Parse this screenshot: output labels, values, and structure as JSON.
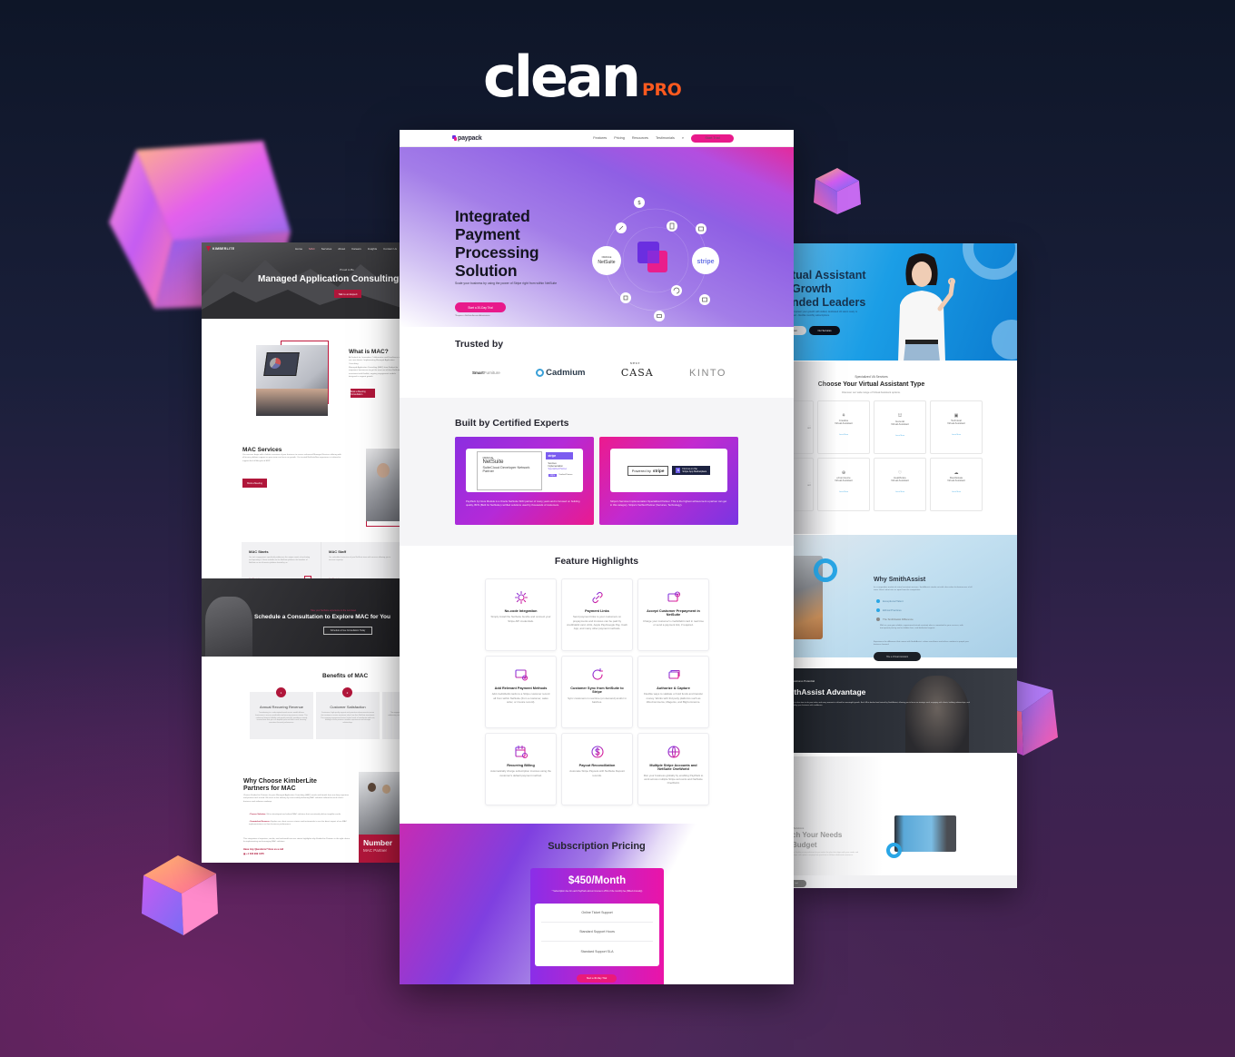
{
  "brand": {
    "word": "clean",
    "suffix": "PRO",
    "accent_color": "#ff5a1f"
  },
  "left_site": {
    "logo": "KIMBERLITE",
    "nav": [
      "Home",
      "MAC",
      "Services",
      "About",
      "Careers",
      "Insights",
      "Contact Us"
    ],
    "hero": {
      "kicker": "Proud to Be",
      "title": "Managed Application Consulting",
      "button": "Talk to an Expert"
    },
    "what_is": {
      "title": "What is MAC?",
      "text1": "At KimberLite, Innovation, Collaboration and Excellence are our core drivers. Implementing Managed Application Consulting.",
      "text2": "Managed Application Consulting (MAC) from KimberLite empowers businesses to get the most out of their NetSuite investment with flexible, ongoing engagement models designed to support growth.",
      "button": "Book a Meeting Consultation"
    },
    "services": {
      "title": "MAC Services",
      "text": "Our services begin with a holistic overview of your business to assess enhanced Managed Services offering with all-in-one platform support so your team can focus on growth. Our trusted NetSuiteNow experience is tailored to support the full lifecycle of ERP.",
      "button": "Book a Meeting"
    },
    "cards": [
      {
        "title": "MAC Starts",
        "text": "Our tech engagement specifically addresses the unique needs of evaluating and operating a 1-item scalable via the NetSuite platform: the baseline of NetSuite as an all-service platform hosted by us.",
        "link": "Get Started"
      },
      {
        "title": "MAC Staff",
        "text": "Our embedded extension of your NetSuite team with services allowing you to increase capacity.",
        "link": "Get Started"
      }
    ],
    "cta": {
      "kicker": "Take your NetSuite experience to the next level",
      "title": "Schedule a Consultation to Explore MAC for You",
      "button": "Schedule a Free Consultation Today"
    },
    "benefits": {
      "title": "Benefits of MAC",
      "items": [
        {
          "num": "1",
          "title": "Annual Recurring Revenue",
          "text": "Transitioning to a subscription-based service model delivers businesses a secure, predictable and recurring revenue stream. This enhances financial stability and growth potential, providing a steady income base that you can depend upon and often used, ensuring consistent financial performance."
        },
        {
          "num": "2",
          "title": "Customer Satisfaction",
          "text": "Continuous, high-quality support and proactive enhancements ensure that customers receive maximum value from their NetSuite investment. This ongoing engagement fosters higher levels of satisfaction and trust, leading to more positive customer experiences and stronger relationships."
        },
        {
          "num": "3",
          "title": "Cu",
          "text": "The engagement model fosters strong, long-term relationships, addressing customer needs and ensuring consistent satisfaction and higher retention rates."
        }
      ]
    },
    "why": {
      "title": "Why Choose KimberLite Partners for MAC",
      "text": "Choose KimberLite Partners for your Managed Application Consulting (MAC) needs and benefit from our deep expertise and proven track record. We excel in the industry by successfully delivering MAC solutions tailored to each client's business and software roadmap.",
      "bullets": [
        {
          "label": "Proven Solution:",
          "text": "We've developed and refined MAC solutions that consistently deliver tangible results."
        },
        {
          "label": "Unmatched Success:",
          "text": "Explore our client success stories and testimonials to see the direct impact of our MAC implementations on their business performance."
        }
      ],
      "closing": "This integration of expertise, results, and real-world success stories highlights why KimberLite Partners is the right choice for implementing and managing MAC solutions.",
      "contact_label": "Have Any Questions? Give us a call",
      "phone": "+1 333 999 4476",
      "badge_title": "Number",
      "badge_sub": "MAC Partner"
    },
    "accent_color": "#b0163a"
  },
  "center_site": {
    "logo": "paypack",
    "nav": [
      "Features",
      "Pricing",
      "Resources",
      "Testimonials"
    ],
    "nav_button": "Start Trial",
    "hero": {
      "title": "Integrated Payment Processing Solution",
      "subtitle": "Scale your business by using the power of Stripe right from within NetSuite",
      "button": "Start a 30-Day Trial",
      "note": "*Requires a NetSuite Account Administrator",
      "orbit_labels": {
        "left": "NetSuite",
        "left_small": "ORACLE",
        "right": "stripe"
      }
    },
    "trusted": {
      "title": "Trusted by",
      "logos": [
        {
          "name": "SmartFurniture",
          "bold": "Smart",
          "light": "Furniture"
        },
        {
          "name": "Cadmium",
          "text": "Cadmium"
        },
        {
          "name": "Nest Casa",
          "small": "NEST",
          "text": "CASA"
        },
        {
          "name": "Kinto",
          "text": "KINTO"
        }
      ]
    },
    "certified": {
      "title": "Built by Certified Experts",
      "cards": [
        {
          "badge1": {
            "small": "ORACLE",
            "name": "NetSuite",
            "desc": "SuiteCloud Developer Network Partner"
          },
          "badge2": {
            "top": "stripe",
            "line1": "Services",
            "line2": "Implementation",
            "line3": "Specialized Partner",
            "tag": "stripe",
            "tag_text": "Verified Partner"
          },
          "text": "PayPack by Nova Module is a Oracle NetSuite SDN partner of many years and is focused on building quality, BFN (Built for NetSuite) certified solutions used by thousands of customers."
        },
        {
          "powered": {
            "label": "Powered by",
            "brand": "stripe"
          },
          "marketplace": {
            "icon": "S",
            "line1": "Find us on the",
            "line2": "Stripe App Marketplace"
          },
          "text": "Stripe's Services Implementation Specialized Partner. This is the highest achievement a partner can get in this category. Stripe's Verified Partner (Services, Technology)."
        }
      ]
    },
    "features": {
      "title": "Feature Highlights",
      "items": [
        {
          "icon": "gear-icon",
          "title": "No-code Integration",
          "text": "Simply install the NetSuite bundle and connect your Stripe API credentials."
        },
        {
          "icon": "link-icon",
          "title": "Payment Links",
          "text": "Send payment links to your customers on prepayments and invoices can be paid by credit/debit card, ACH, Apple Pay/Google Pay, Cash App, and many other payment methods."
        },
        {
          "icon": "card-check-icon",
          "title": "Accept Customer Prepayment in NetSuite",
          "text": "Charge your customer's credit/debit card in real time or send a payment link, if required."
        },
        {
          "icon": "card-add-icon",
          "title": "Add Relevant Payment Methods",
          "text": "Add credit/debit cards to a Stripe customer record all from within NetSuite (from a customer, sales order, or invoice record)."
        },
        {
          "icon": "sync-icon",
          "title": "Customer Sync from NetSuite to Stripe",
          "text": "Sync customers in real time (on demand) and/or in batches."
        },
        {
          "icon": "cards-icon",
          "title": "Authorize & Capture",
          "text": "Flexible ways to validate or hold funds and transfer money. Works with 3rd party platforms such as WooCommerce, Magento, and BigCommerce."
        },
        {
          "icon": "calendar-icon",
          "title": "Recurring Billing",
          "text": "Automatically charge subscription invoices using the customer's default payment method."
        },
        {
          "icon": "dollar-icon",
          "title": "Payout Reconciliation",
          "text": "Automate Stripe Payouts with NetSuite Deposit records."
        },
        {
          "icon": "globe-icon",
          "title": "Multiple Stripe Accounts and NetSuite OneWorld",
          "text": "Run your business globally by enabling PayPack to work across multiple Stripe accounts and NetSuite OneWorld."
        }
      ]
    },
    "pricing": {
      "title": "Subscription Pricing",
      "amount": "$450/Month",
      "note": "* Subscription fee for each PayPack add-on license is 25% of the monthly fee (Billed Annually)",
      "items": [
        "Online Ticket Support",
        "Standard Support Hours",
        "Standard Support SLA"
      ],
      "button": "Start a 30-Day Trial"
    },
    "colors": {
      "primary": "#e8198b",
      "purple": "#8f5fe4"
    }
  },
  "right_site": {
    "hero": {
      "title_lines": [
        "tual Assistant",
        " Growth",
        "nded Leaders"
      ],
      "subtitle": "Empower your growth with skilled, dedicated VA talent ready to start - flexible monthly subscriptions.",
      "button_light": "tact",
      "button_dark": "Our Services"
    },
    "services": {
      "kicker": "Specialized VA Services",
      "title": "Choose Your Virtual Assistant Type",
      "subtitle": "Discover our wide range of Virtual Assistant options.",
      "tiles": [
        {
          "name": "...\nant",
          "link": ""
        },
        {
          "icon": "palette-icon",
          "name": "Creative\nVirtual Assistant",
          "link": "Learn More"
        },
        {
          "icon": "briefcase-icon",
          "name": "General\nVirtual Assistant",
          "link": "Learn More"
        },
        {
          "icon": "monitor-icon",
          "name": "Technical\nVirtual Assistant",
          "link": "Learn More"
        },
        {
          "name": "...\nant",
          "link": ""
        },
        {
          "icon": "cart-icon",
          "name": "eCommerce\nVirtual Assistant",
          "link": "Learn More"
        },
        {
          "icon": "heart-icon",
          "name": "Healthcare\nVirtual Assistant",
          "link": "Learn More"
        },
        {
          "icon": "cloud-icon",
          "name": "Real Estate\nVirtual Assistant",
          "link": "Learn More"
        }
      ]
    },
    "why": {
      "title": "Why SmithAssist",
      "text": "In a competitive market of virtual assistant services, SmithAssist stands out with clear value for businesses of all sizes. Here's what sets us apart from the competition.",
      "items": [
        "Exceptional Talent",
        "Ethical Practices",
        "The SmithAssist Difference"
      ],
      "detail": "With us, you gain reliable, experienced virtual assistant who is committed to your success, with transparent pricing and no hidden fees, and dedicated support.",
      "closing": "Experience the difference that comes with SmithAssist - where excellence and ethics combine to propel your business forward.",
      "button": "Hire a Virtual Assistant"
    },
    "advantage": {
      "kicker": "Business Potential",
      "title": "ithAssist Advantage",
      "text": "Let us free time to do your tasks, and every moment is utilized for meaningful growth. Each VA is backed and trained by SmithAssist, allowing you to focus on strategic work, engaging with clients, building relationships, and scaling your business with confidence."
    },
    "match": {
      "kicker": "r Solutions",
      "title_lines": [
        "ch Your Needs",
        " Budget"
      ],
      "text": "Our flexible pricing solutions let you select the plan that aligns with your needs and budget, with options ranging from part-time to full-time dedicated assistance.",
      "button": "ted"
    },
    "accent_color": "#29a6e6"
  }
}
